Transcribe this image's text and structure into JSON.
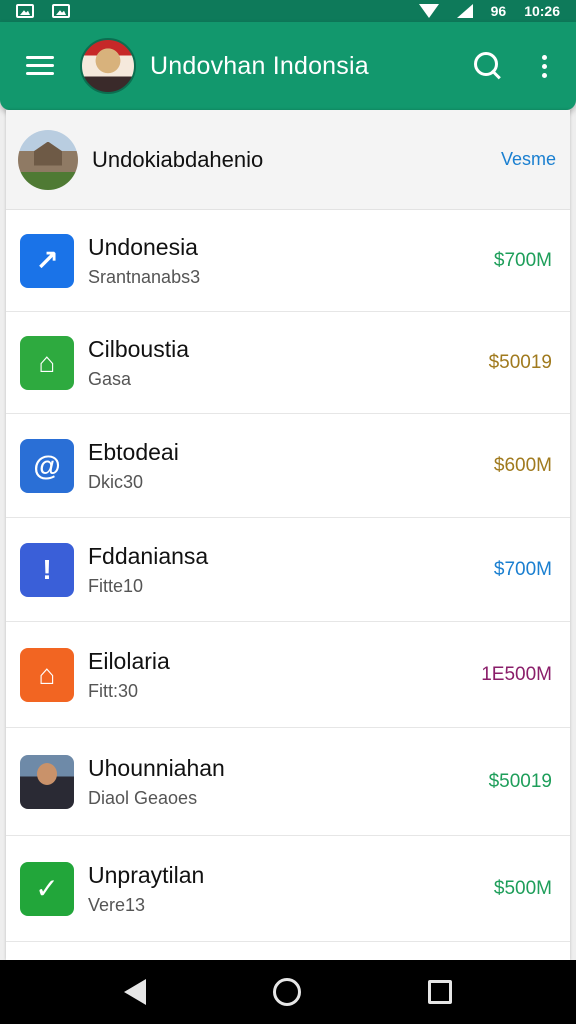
{
  "status_bar": {
    "battery": "96",
    "time": "10:26"
  },
  "app_bar": {
    "title": "Undovhan Indonsia",
    "menu_icon": "hamburger-icon",
    "search_icon": "search-icon",
    "overflow_icon": "more-vert-icon"
  },
  "header": {
    "title": "Undokiabdahenio",
    "action": "Vesme"
  },
  "items": [
    {
      "title": "Undonesia",
      "subtitle": "Srantnanabs3",
      "price": "$700M",
      "icon": "arrow-icon",
      "glyph": "↗",
      "icon_bg": "#1a73e8",
      "price_color": "#1e9e5a"
    },
    {
      "title": "Cilboustia",
      "subtitle": "Gasa",
      "price": "$50019",
      "icon": "home-outline-icon",
      "glyph": "⌂",
      "icon_bg": "#2eaa3f",
      "price_color": "#a07a1e"
    },
    {
      "title": "Ebtodeai",
      "subtitle": "Dkic30",
      "price": "$600M",
      "icon": "swirl-icon",
      "glyph": "@",
      "icon_bg": "#2a6fd6",
      "price_color": "#a07a1e"
    },
    {
      "title": "Fddaniansa",
      "subtitle": "Fitte10",
      "price": "$700M",
      "icon": "chat-info-icon",
      "glyph": "!",
      "icon_bg": "#3a5fd8",
      "price_color": "#1a7fd0"
    },
    {
      "title": "Eilolaria",
      "subtitle": "Fitt:30",
      "price": "1E500M",
      "icon": "house-icon",
      "glyph": "⌂",
      "icon_bg": "#f26522",
      "price_color": "#8a1e6a"
    },
    {
      "title": "Uhounniahan",
      "subtitle": "Diaol Geaoes",
      "price": "$50019",
      "icon": "person-photo-icon",
      "glyph": "",
      "icon_bg": "photo",
      "price_color": "#1e9e5a"
    },
    {
      "title": "Unpraytilan",
      "subtitle": "Vere13",
      "price": "$500M",
      "icon": "bird-icon",
      "glyph": "✓",
      "icon_bg": "#22a63a",
      "price_color": "#1e9e5a"
    }
  ],
  "nav": {
    "back_icon": "back-icon",
    "home_icon": "home-icon",
    "recents_icon": "recents-icon"
  }
}
